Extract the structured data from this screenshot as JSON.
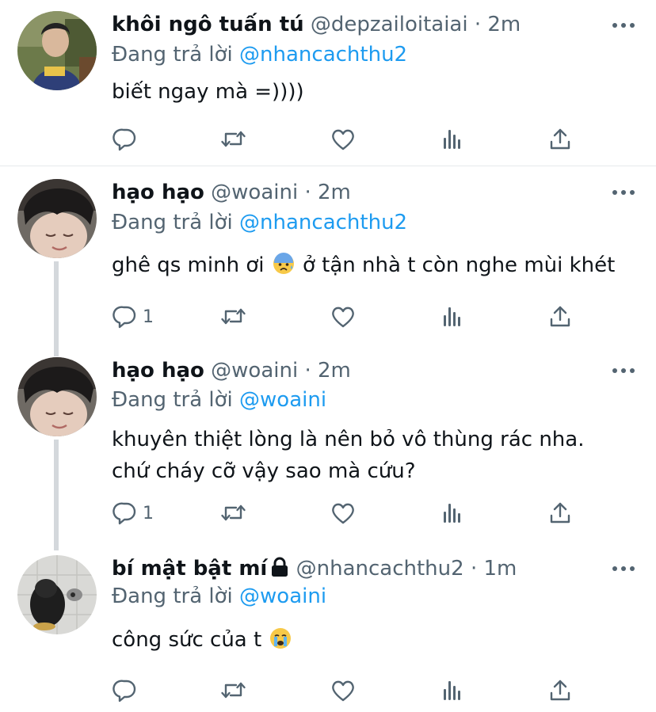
{
  "tweets": [
    {
      "name": "khôi ngô tuấn tú",
      "handle": "@depzailoitaiai",
      "time": "2m",
      "reply_prefix": "Đang trả lời ",
      "reply_to": "@nhancachthu2",
      "text_lines": [
        "biết ngay mà =))))"
      ],
      "reply_count": "",
      "avatar": "avatar-boy-outdoor"
    },
    {
      "name": "hạo hạo",
      "handle": "@woaini",
      "time": "2m",
      "reply_prefix": "Đang trả lời ",
      "reply_to": "@nhancachthu2",
      "text_before_emoji": "ghê qs minh ơi ",
      "text_after_emoji": " ở tận nhà t còn nghe mùi khét",
      "emoji": "anxious-face-emoji",
      "reply_count": "1",
      "avatar": "avatar-selfie"
    },
    {
      "name": "hạo hạo",
      "handle": "@woaini",
      "time": "2m",
      "reply_prefix": "Đang trả lời ",
      "reply_to": "@woaini",
      "text_lines": [
        "khuyên thiệt lòng là nên bỏ vô thùng rác nha.",
        "chứ cháy cỡ vậy sao mà cứu?"
      ],
      "reply_count": "1",
      "avatar": "avatar-selfie"
    },
    {
      "name": "bí mật bật mí",
      "handle": "@nhancachthu2",
      "time": "1m",
      "reply_prefix": "Đang trả lời ",
      "reply_to": "@woaini",
      "text_before_emoji": "công sức của t ",
      "emoji": "crying-face-emoji",
      "reply_count": "",
      "avatar": "avatar-burnt-object",
      "locked_icon": "lock-icon"
    }
  ],
  "dot": "·",
  "colors": {
    "text": "#0f1419",
    "secondary": "#536471",
    "link": "#1d9bf0",
    "divider": "#e6e9eb",
    "thread_line": "#d4d8dc"
  },
  "action_icons": [
    "reply-icon",
    "retweet-icon",
    "like-icon",
    "views-icon",
    "share-icon"
  ]
}
